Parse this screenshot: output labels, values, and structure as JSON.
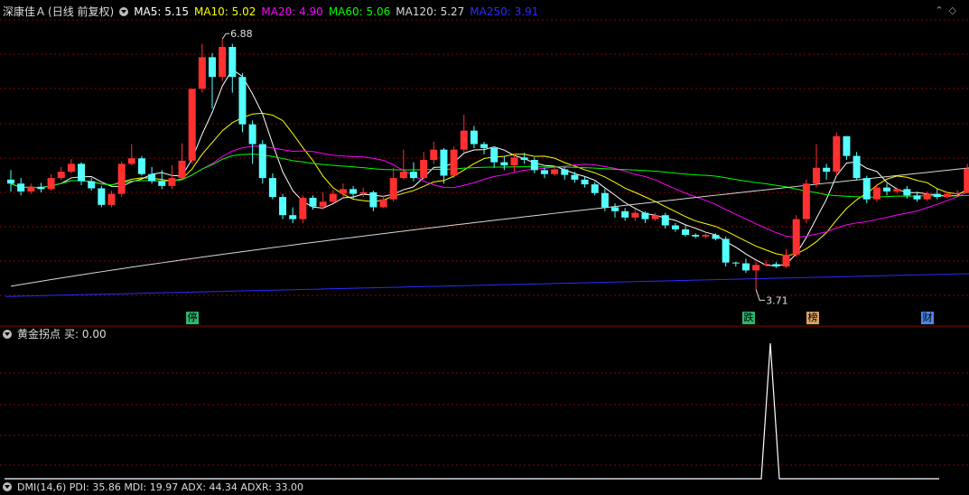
{
  "header": {
    "stock_name": "深康佳Ａ",
    "period": "(日线 前复权)",
    "ma5": {
      "label": "MA5: 5.15",
      "color": "#ffffff"
    },
    "ma10": {
      "label": "MA10: 5.02",
      "color": "#ffff00"
    },
    "ma20": {
      "label": "MA20: 4.90",
      "color": "#ff00ff"
    },
    "ma60": {
      "label": "MA60: 5.06",
      "color": "#00ff00"
    },
    "ma120": {
      "label": "MA120: 5.27",
      "color": "#d8d8d8"
    },
    "ma250": {
      "label": "MA250: 3.91",
      "color": "#2b2bff"
    }
  },
  "annotations": {
    "high": "6.88",
    "low": "3.71"
  },
  "badges": [
    {
      "text": "停",
      "bg": "#2fb36e"
    },
    {
      "text": "跌",
      "bg": "#2fb36e"
    },
    {
      "text": "榜",
      "bg": "#d8a060"
    },
    {
      "text": "财",
      "bg": "#4a86e8"
    }
  ],
  "indicator": {
    "title": "黄金拐点",
    "value_label": "买: 0.00"
  },
  "bottom_indicator": {
    "text": "DMI(14,6)  PDI: 35.86  MDI: 19.97  ADX: 44.34  ADXR: 33.00"
  },
  "colors": {
    "up": "#ff3030",
    "down": "#54ffff",
    "grid": "#8b0000"
  },
  "chart_data": {
    "type": "candlestick",
    "ylim": [
      3.6,
      7.1
    ],
    "candles": [
      [
        5.1,
        5.05,
        5.22,
        4.95
      ],
      [
        5.05,
        4.95,
        5.12,
        4.9
      ],
      [
        4.95,
        5.01,
        5.05,
        4.92
      ],
      [
        5.01,
        4.98,
        5.06,
        4.94
      ],
      [
        4.98,
        5.12,
        5.17,
        4.96
      ],
      [
        5.12,
        5.2,
        5.26,
        5.1
      ],
      [
        5.2,
        5.3,
        5.36,
        5.18
      ],
      [
        5.3,
        5.08,
        5.32,
        5.03
      ],
      [
        5.08,
        4.99,
        5.12,
        4.96
      ],
      [
        4.99,
        4.78,
        5.02,
        4.75
      ],
      [
        4.78,
        4.92,
        4.96,
        4.75
      ],
      [
        4.92,
        5.3,
        5.33,
        4.88
      ],
      [
        5.3,
        5.37,
        5.55,
        5.28
      ],
      [
        5.37,
        5.17,
        5.4,
        5.15
      ],
      [
        5.17,
        5.08,
        5.26,
        5.05
      ],
      [
        5.08,
        5.02,
        5.22,
        4.98
      ],
      [
        5.02,
        5.12,
        5.28,
        4.98
      ],
      [
        5.12,
        5.34,
        5.56,
        5.1
      ],
      [
        5.34,
        6.25,
        6.25,
        5.3
      ],
      [
        6.25,
        6.65,
        6.82,
        6.2
      ],
      [
        6.65,
        6.4,
        6.7,
        6.0
      ],
      [
        6.4,
        6.78,
        6.88,
        6.35
      ],
      [
        6.78,
        6.4,
        6.82,
        6.2
      ],
      [
        6.4,
        5.8,
        6.45,
        5.7
      ],
      [
        5.8,
        5.55,
        5.85,
        5.3
      ],
      [
        5.55,
        5.12,
        5.6,
        5.05
      ],
      [
        5.12,
        4.88,
        5.18,
        4.85
      ],
      [
        4.88,
        4.65,
        4.92,
        4.6
      ],
      [
        4.65,
        4.6,
        4.75,
        4.55
      ],
      [
        4.6,
        4.87,
        4.9,
        4.55
      ],
      [
        4.87,
        4.76,
        4.9,
        4.72
      ],
      [
        4.76,
        4.82,
        4.94,
        4.72
      ],
      [
        4.82,
        4.92,
        4.97,
        4.8
      ],
      [
        4.92,
        4.98,
        5.05,
        4.88
      ],
      [
        4.98,
        4.92,
        5.02,
        4.86
      ],
      [
        4.92,
        4.94,
        5.0,
        4.88
      ],
      [
        4.94,
        4.75,
        4.96,
        4.7
      ],
      [
        4.75,
        4.85,
        4.9,
        4.74
      ],
      [
        4.85,
        5.12,
        5.25,
        4.82
      ],
      [
        5.12,
        5.2,
        5.48,
        5.1
      ],
      [
        5.2,
        5.12,
        5.32,
        5.08
      ],
      [
        5.12,
        5.35,
        5.45,
        5.1
      ],
      [
        5.35,
        5.48,
        5.58,
        5.3
      ],
      [
        5.48,
        5.15,
        5.5,
        5.05
      ],
      [
        5.15,
        5.48,
        5.52,
        5.12
      ],
      [
        5.48,
        5.72,
        5.92,
        5.45
      ],
      [
        5.72,
        5.55,
        5.78,
        5.5
      ],
      [
        5.55,
        5.5,
        5.58,
        5.42
      ],
      [
        5.5,
        5.32,
        5.52,
        5.25
      ],
      [
        5.32,
        5.28,
        5.4,
        5.22
      ],
      [
        5.28,
        5.38,
        5.42,
        5.2
      ],
      [
        5.38,
        5.35,
        5.44,
        5.3
      ],
      [
        5.35,
        5.22,
        5.38,
        5.18
      ],
      [
        5.22,
        5.17,
        5.25,
        5.12
      ],
      [
        5.17,
        5.23,
        5.28,
        5.15
      ],
      [
        5.23,
        5.16,
        5.26,
        5.1
      ],
      [
        5.16,
        5.1,
        5.2,
        5.06
      ],
      [
        5.1,
        5.04,
        5.14,
        5.0
      ],
      [
        5.04,
        4.93,
        5.07,
        4.9
      ],
      [
        4.93,
        4.75,
        4.98,
        4.7
      ],
      [
        4.75,
        4.7,
        4.8,
        4.62
      ],
      [
        4.7,
        4.62,
        4.74,
        4.58
      ],
      [
        4.62,
        4.68,
        4.72,
        4.58
      ],
      [
        4.68,
        4.6,
        4.7,
        4.55
      ],
      [
        4.6,
        4.65,
        4.68,
        4.58
      ],
      [
        4.65,
        4.52,
        4.68,
        4.48
      ],
      [
        4.52,
        4.47,
        4.55,
        4.44
      ],
      [
        4.47,
        4.4,
        4.52,
        4.38
      ],
      [
        4.4,
        4.38,
        4.42,
        4.36
      ],
      [
        4.38,
        4.4,
        4.42,
        4.35
      ],
      [
        4.4,
        4.35,
        4.42,
        4.33
      ],
      [
        4.35,
        4.05,
        4.38,
        4.0
      ],
      [
        4.05,
        4.04,
        4.06,
        4.0
      ],
      [
        4.04,
        3.95,
        4.1,
        3.92
      ],
      [
        3.95,
        4.02,
        4.06,
        3.71
      ],
      [
        4.02,
        4.03,
        4.08,
        4.0
      ],
      [
        4.03,
        4.0,
        4.06,
        3.98
      ],
      [
        4.0,
        4.15,
        4.22,
        3.98
      ],
      [
        4.15,
        4.6,
        4.65,
        4.12
      ],
      [
        4.6,
        5.05,
        5.1,
        4.55
      ],
      [
        5.05,
        5.25,
        5.55,
        5.0
      ],
      [
        5.25,
        5.2,
        5.3,
        5.1
      ],
      [
        5.2,
        5.65,
        5.7,
        5.15
      ],
      [
        5.65,
        5.4,
        5.65,
        5.35
      ],
      [
        5.4,
        5.12,
        5.45,
        5.1
      ],
      [
        5.12,
        4.85,
        5.15,
        4.8
      ],
      [
        4.85,
        5.0,
        5.05,
        4.82
      ],
      [
        5.0,
        4.95,
        5.05,
        4.9
      ],
      [
        4.95,
        4.98,
        5.0,
        4.92
      ],
      [
        4.98,
        4.9,
        5.02,
        4.86
      ],
      [
        4.9,
        4.85,
        4.95,
        4.82
      ],
      [
        4.85,
        4.92,
        4.95,
        4.83
      ],
      [
        4.92,
        4.88,
        4.98,
        4.85
      ],
      [
        4.88,
        4.92,
        4.95,
        4.86
      ],
      [
        4.92,
        4.93,
        4.97,
        4.88
      ],
      [
        4.93,
        5.24,
        5.3,
        4.93
      ],
      [
        5.24,
        5.55,
        5.56,
        5.2
      ]
    ]
  }
}
